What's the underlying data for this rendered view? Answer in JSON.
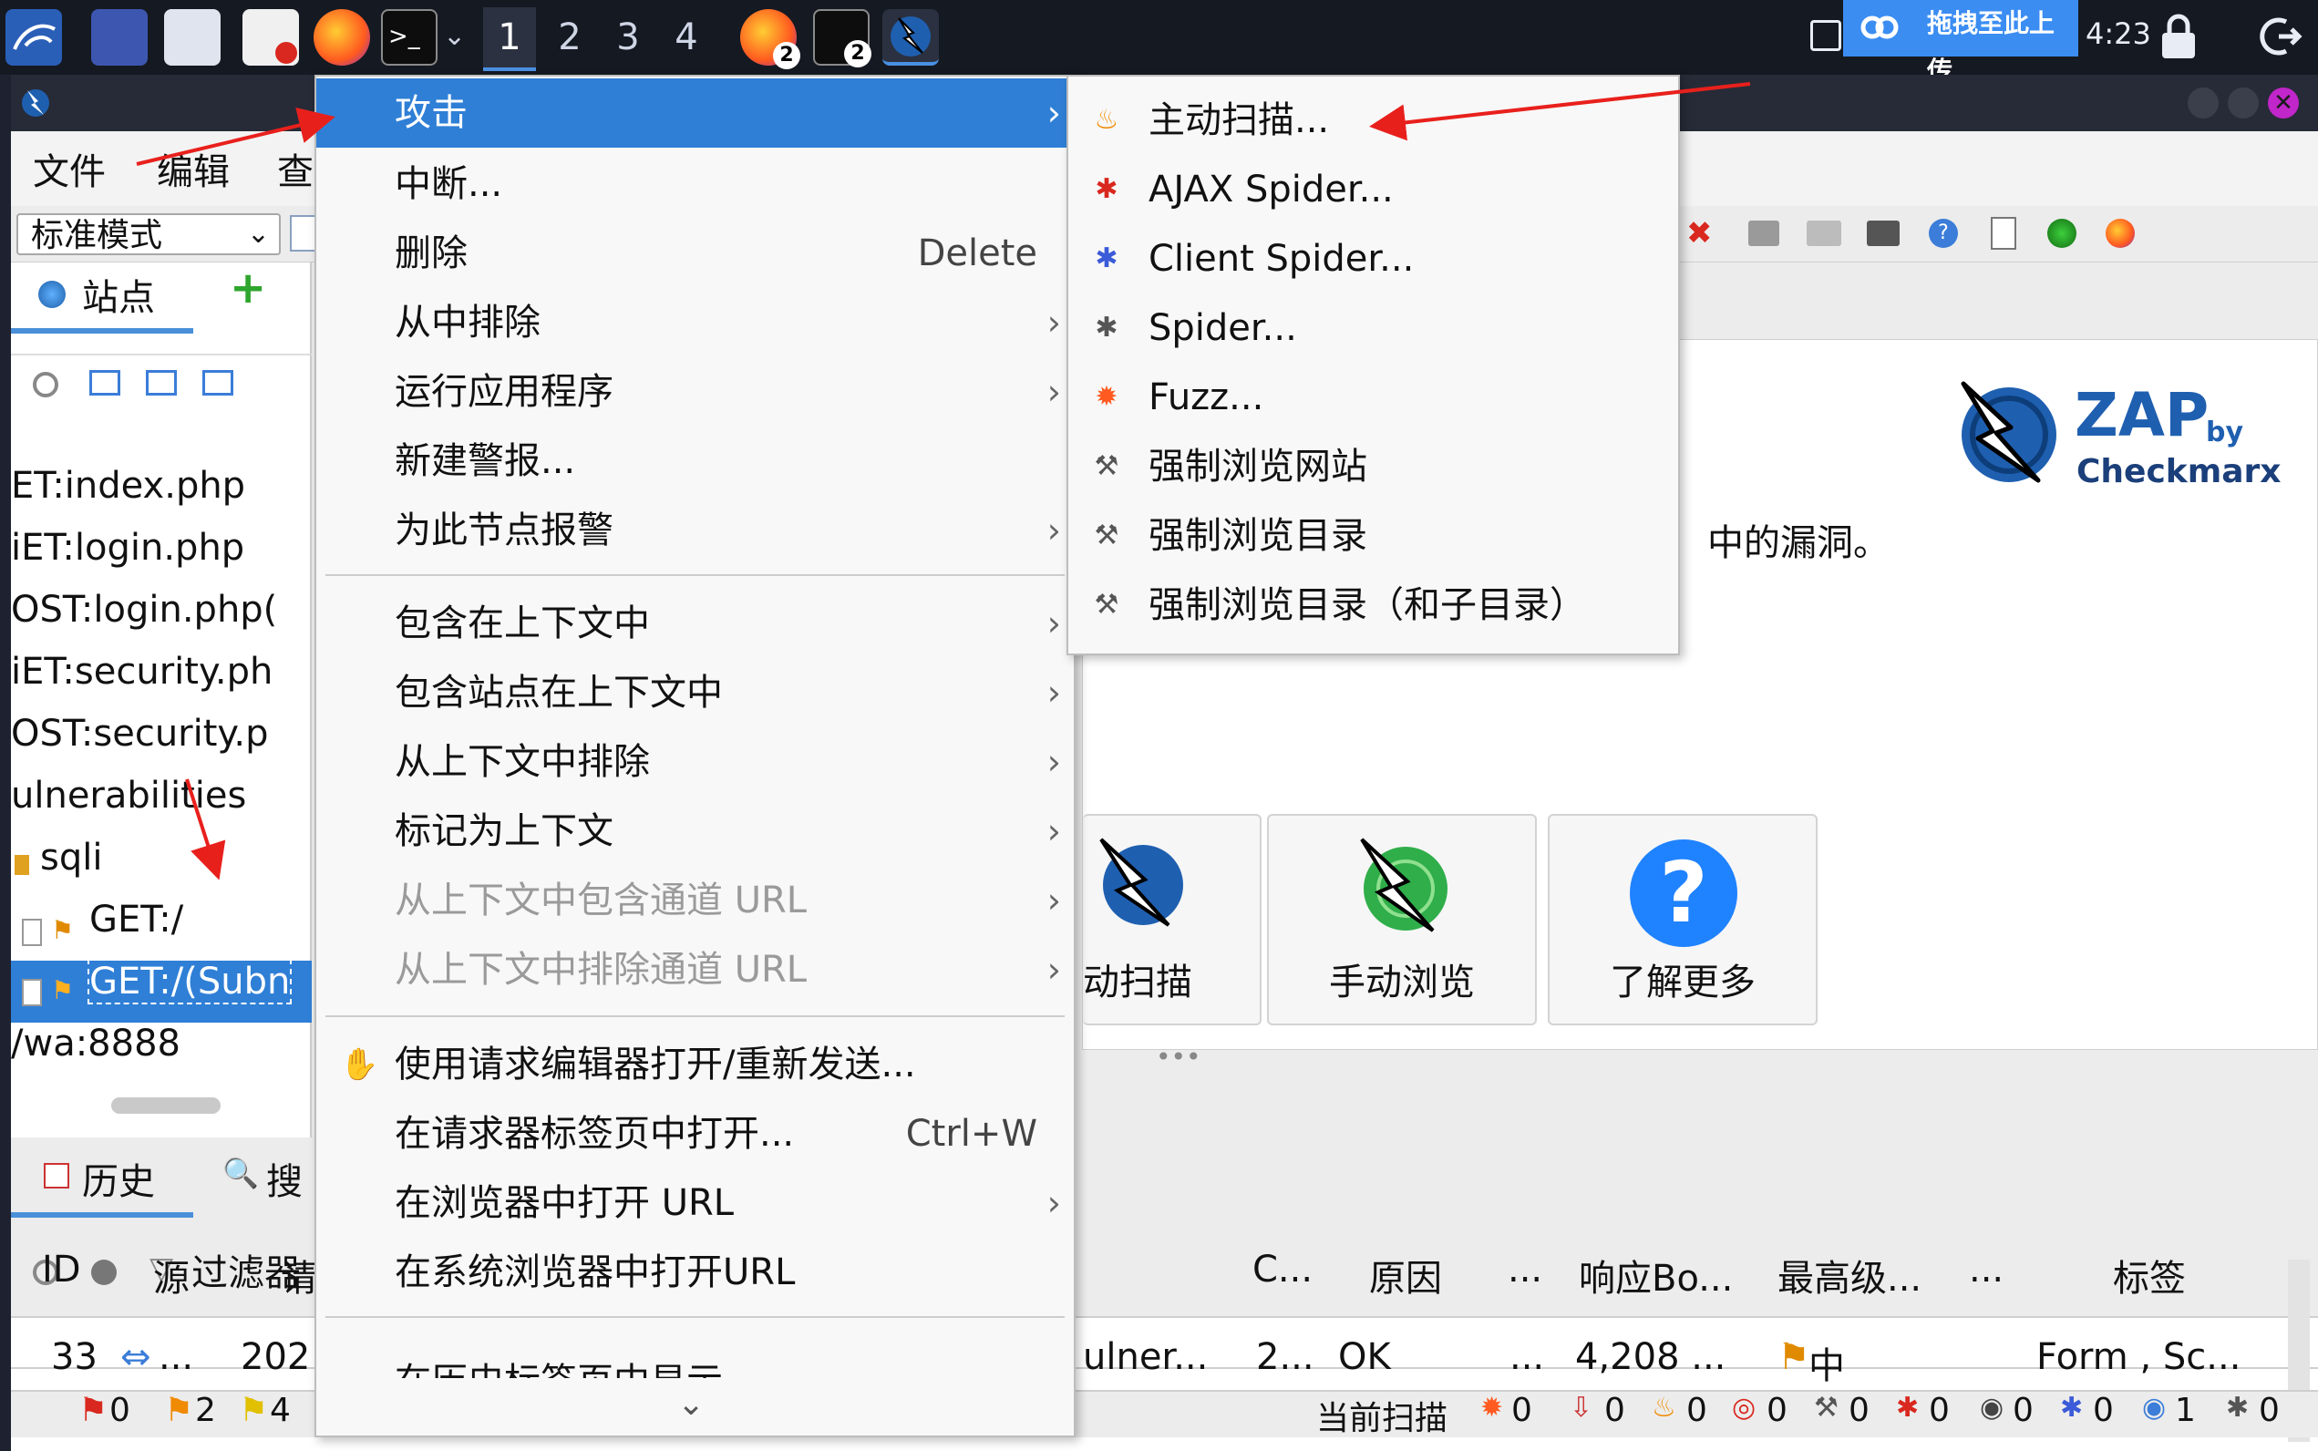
{
  "taskbar": {
    "workspaces": [
      "1",
      "2",
      "3",
      "4"
    ],
    "badges": [
      "2",
      "2"
    ],
    "upload_label": "拖拽至此上传",
    "clock": "4:23"
  },
  "menubar": {
    "items": [
      "文件",
      "编辑",
      "查"
    ]
  },
  "toolbar": {
    "mode": "标准模式"
  },
  "sites_panel": {
    "tab_label": "站点",
    "tree": [
      "ET:index.php",
      "iET:login.php",
      "OST:login.php(",
      "iET:security.ph",
      "OST:security.p",
      "ulnerabilities",
      "sqli",
      "GET:/",
      "GET:/(Subn",
      "/wa:8888"
    ]
  },
  "welcome": {
    "text_fragment": "中的漏洞。",
    "logo_text": "ZAP",
    "logo_by": "by",
    "logo_brand": "Checkmarx",
    "btn_auto": "动扫描",
    "btn_manual": "手动浏览",
    "btn_learn": "了解更多"
  },
  "history": {
    "tab_history": "历史",
    "tab_search": "搜",
    "filter": "过滤器",
    "columns": [
      "ID",
      "源",
      "请",
      "C...",
      "原因",
      "...",
      "响应Bo...",
      "最高级...",
      "...",
      "标签"
    ],
    "row": {
      "id": "33",
      "src": "...",
      "req": "202",
      "url": "ulner...",
      "code": "2...",
      "reason": "OK",
      "dots": "...",
      "size": "4,208 ...",
      "level": "中",
      "tags": "Form , Sc..."
    }
  },
  "statusbar": {
    "left_counts": [
      "0",
      "2",
      "4"
    ],
    "current_scans_label": "当前扫描",
    "scan_counts": [
      "0",
      "0",
      "0",
      "0",
      "0",
      "0",
      "0",
      "0",
      "1",
      "0"
    ]
  },
  "context_menu": {
    "items": [
      {
        "label": "攻击",
        "shortcut": "",
        "submenu": true,
        "disabled": false,
        "highlight": true
      },
      {
        "label": "中断...",
        "shortcut": "",
        "submenu": false,
        "disabled": false
      },
      {
        "label": "删除",
        "shortcut": "Delete",
        "submenu": false,
        "disabled": false
      },
      {
        "label": "从中排除",
        "shortcut": "",
        "submenu": true,
        "disabled": false
      },
      {
        "label": "运行应用程序",
        "shortcut": "",
        "submenu": true,
        "disabled": false
      },
      {
        "label": "新建警报...",
        "shortcut": "",
        "submenu": false,
        "disabled": false
      },
      {
        "label": "为此节点报警",
        "shortcut": "",
        "submenu": true,
        "disabled": false
      },
      {
        "label": "包含在上下文中",
        "shortcut": "",
        "submenu": true,
        "disabled": false
      },
      {
        "label": "包含站点在上下文中",
        "shortcut": "",
        "submenu": true,
        "disabled": false
      },
      {
        "label": "从上下文中排除",
        "shortcut": "",
        "submenu": true,
        "disabled": false
      },
      {
        "label": "标记为上下文",
        "shortcut": "",
        "submenu": true,
        "disabled": false
      },
      {
        "label": "从上下文中包含通道 URL",
        "shortcut": "",
        "submenu": true,
        "disabled": true
      },
      {
        "label": "从上下文中排除通道 URL",
        "shortcut": "",
        "submenu": true,
        "disabled": true
      },
      {
        "label": "使用请求编辑器打开/重新发送...",
        "shortcut": "",
        "submenu": false,
        "disabled": false
      },
      {
        "label": "在请求器标签页中打开...",
        "shortcut": "Ctrl+W",
        "submenu": false,
        "disabled": false
      },
      {
        "label": "在浏览器中打开 URL",
        "shortcut": "",
        "submenu": true,
        "disabled": false
      },
      {
        "label": "在系统浏览器中打开URL",
        "shortcut": "",
        "submenu": false,
        "disabled": false
      },
      {
        "label": "在历史标签页中显示",
        "shortcut": "",
        "submenu": false,
        "disabled": false
      }
    ],
    "scroll_down": "⌄"
  },
  "attack_submenu": {
    "items": [
      {
        "label": "主动扫描...",
        "icon": "flame-icon"
      },
      {
        "label": "AJAX Spider...",
        "icon": "spider-red-icon"
      },
      {
        "label": "Client Spider...",
        "icon": "spider-blue-icon"
      },
      {
        "label": "Spider...",
        "icon": "spider-gray-icon"
      },
      {
        "label": "Fuzz...",
        "icon": "fuzz-icon"
      },
      {
        "label": "强制浏览网站",
        "icon": "hammer-icon"
      },
      {
        "label": "强制浏览目录",
        "icon": "hammer-icon"
      },
      {
        "label": "强制浏览目录（和子目录）",
        "icon": "hammer-icon"
      }
    ]
  },
  "colors": {
    "highlight": "#2f7fd6",
    "annotation_arrow": "#e8201c",
    "taskbar_bg": "#151922"
  }
}
